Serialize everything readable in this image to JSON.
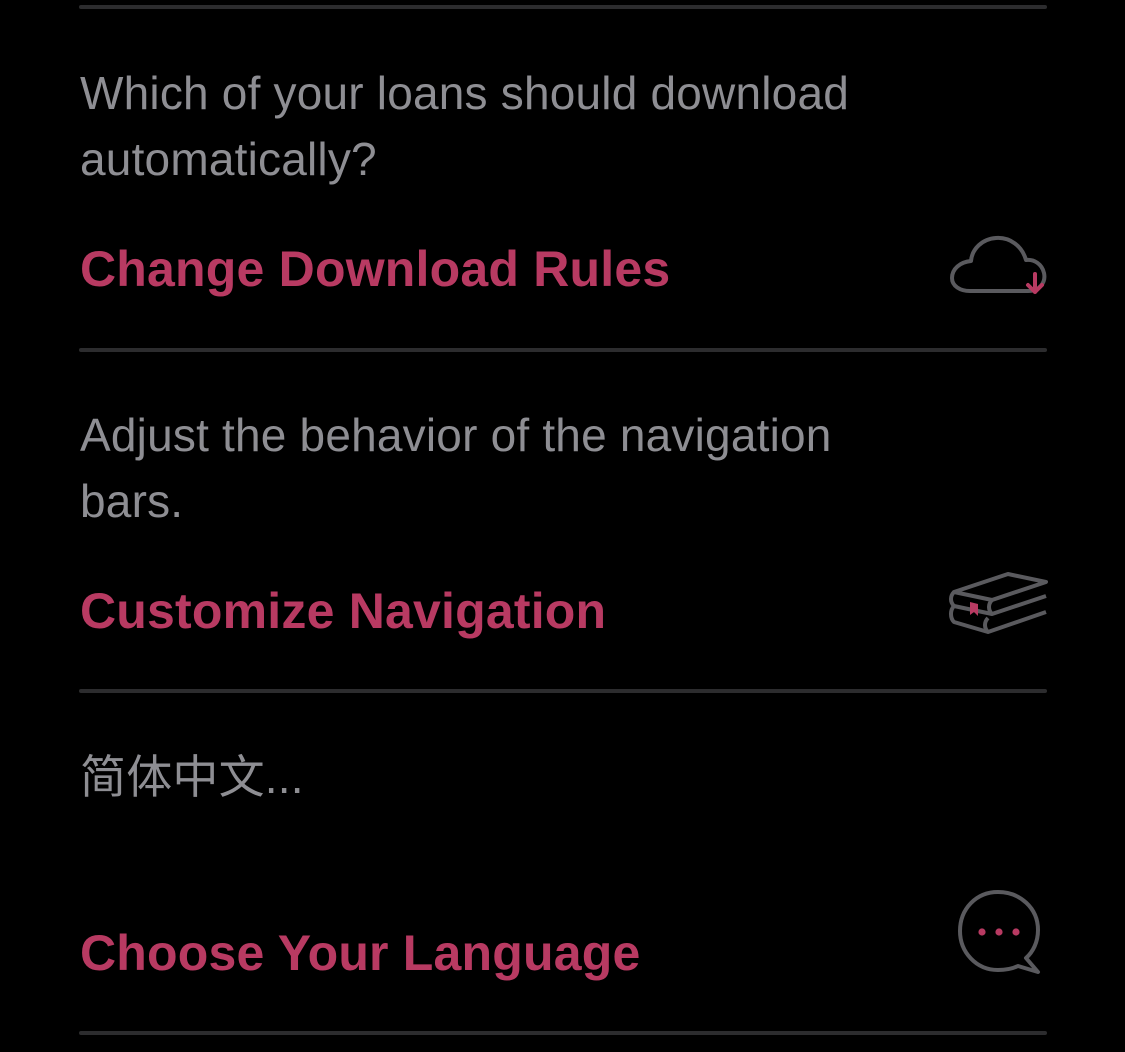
{
  "settings": {
    "download_rules": {
      "description": "Which of your loans should download automatically?",
      "action_label": "Change Download Rules",
      "icon": "cloud-download-icon"
    },
    "navigation": {
      "description": "Adjust the behavior of the navigation bars.",
      "action_label": "Customize Navigation",
      "icon": "books-icon"
    },
    "language": {
      "description": "简体中文...",
      "action_label": "Choose Your Language",
      "icon": "chat-bubble-icon"
    }
  },
  "colors": {
    "background": "#000000",
    "accent": "#b83a62",
    "secondary_text": "#8e8e93",
    "divider": "#2c2c2e",
    "icon_stroke": "#5a5a5e"
  }
}
